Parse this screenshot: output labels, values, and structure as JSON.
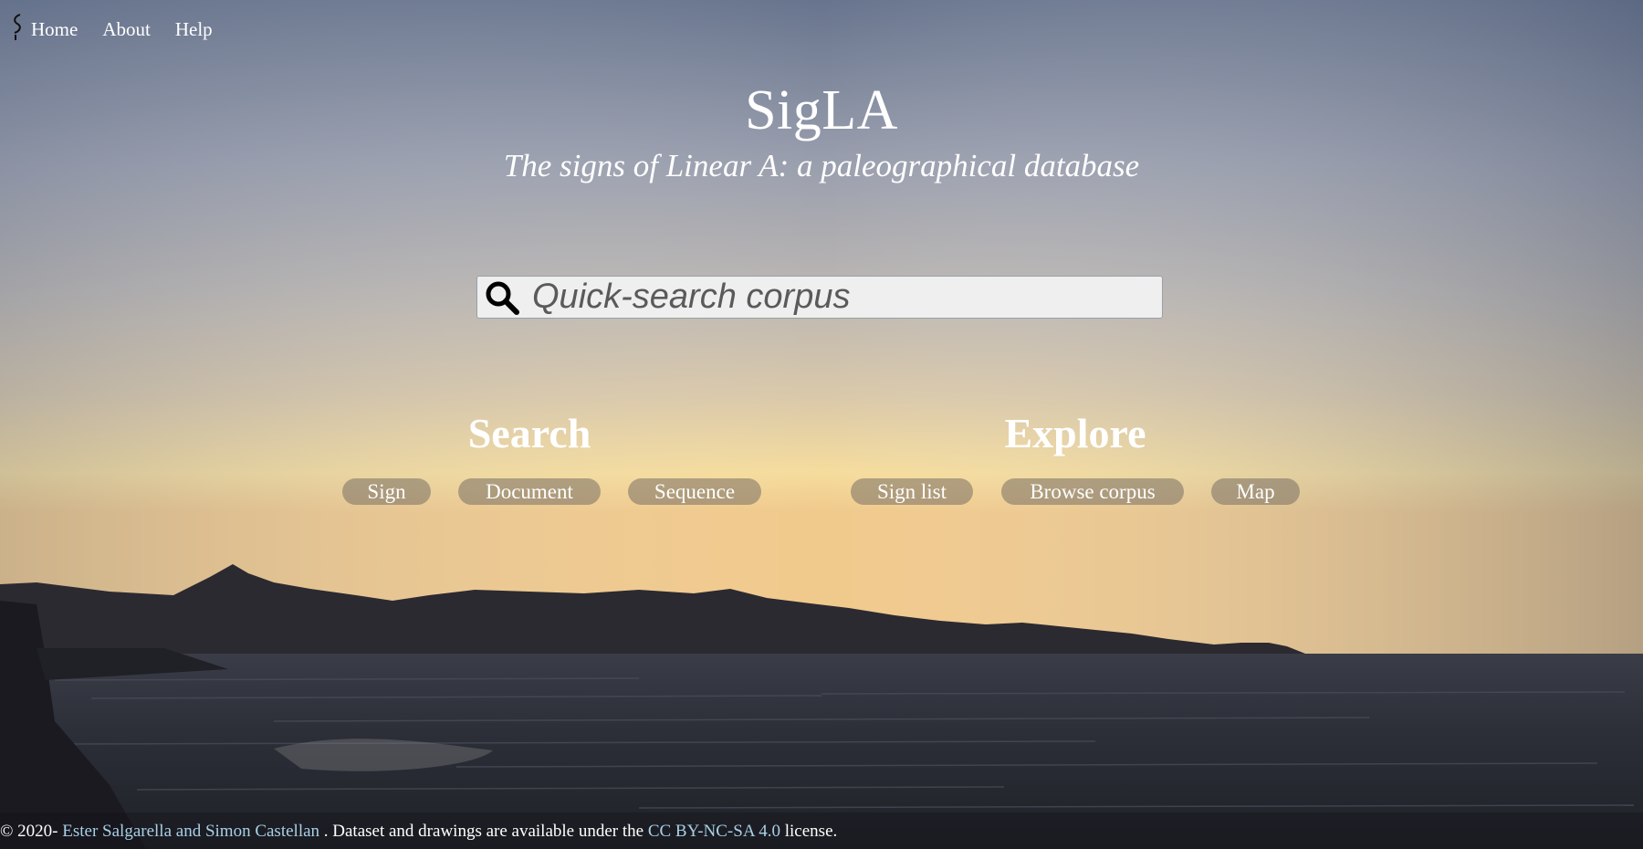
{
  "nav": {
    "items": [
      {
        "label": "Home"
      },
      {
        "label": "About"
      },
      {
        "label": "Help"
      }
    ]
  },
  "hero": {
    "title": "SigLA",
    "subtitle": "The signs of Linear A: a paleographical database"
  },
  "search": {
    "placeholder": "Quick-search corpus",
    "value": ""
  },
  "sections": {
    "search": {
      "title": "Search",
      "buttons": [
        "Sign",
        "Document",
        "Sequence"
      ]
    },
    "explore": {
      "title": "Explore",
      "buttons": [
        "Sign list",
        "Browse corpus",
        "Map"
      ]
    }
  },
  "footer": {
    "prefix": "© 2020- ",
    "authors": "Ester Salgarella and Simon Castellan",
    "middle": " . Dataset and drawings are available under the ",
    "license": "CC BY-NC-SA 4.0",
    "suffix": " license."
  },
  "icons": {
    "logo": "linear-a-sign-logo-icon",
    "search": "magnifier-icon"
  },
  "colors": {
    "sky_top": "#6b7892",
    "sky_mid": "#b7b0ac",
    "horizon": "#f7dfa0",
    "mountains": "#2b2830",
    "sea": "#23262e",
    "link": "#a9cfe6",
    "pill": "#8a8377"
  }
}
